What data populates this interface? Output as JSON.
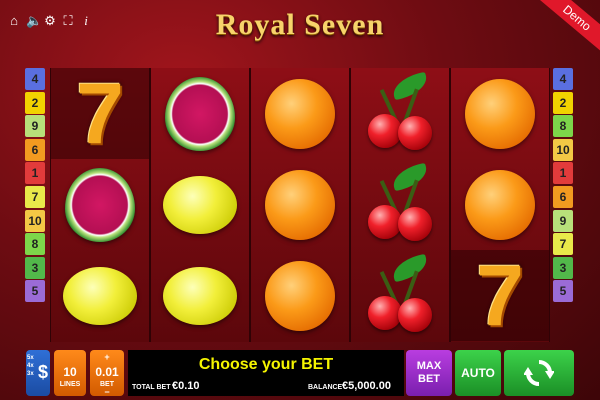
{
  "header": {
    "title": "Royal Seven",
    "demo_label": "Demo",
    "icons": [
      "home-icon",
      "sound-icon",
      "settings-icon",
      "fullscreen-icon",
      "info-icon"
    ]
  },
  "paylines_left": [
    "4",
    "2",
    "9",
    "6",
    "1",
    "7",
    "10",
    "8",
    "3",
    "5"
  ],
  "paylines_right": [
    "4",
    "2",
    "8",
    "10",
    "1",
    "6",
    "9",
    "7",
    "3",
    "5"
  ],
  "payline_colors": {
    "1": "#e23b3b",
    "2": "#f2d200",
    "3": "#52b84a",
    "4": "#5a6fe0",
    "5": "#9b6bd6",
    "6": "#f29a20",
    "7": "#e9e94a",
    "8": "#7dd64a",
    "9": "#b8e07a",
    "10": "#f3c845"
  },
  "reels": [
    [
      "seven",
      "melon",
      "lemon"
    ],
    [
      "melon",
      "lemon",
      "lemon"
    ],
    [
      "orange",
      "orange",
      "orange"
    ],
    [
      "cherry",
      "cherry",
      "cherry"
    ],
    [
      "orange",
      "orange",
      "seven"
    ]
  ],
  "controls": {
    "coin_multipliers": [
      "5x",
      "4x",
      "3x"
    ],
    "coin_symbol": "$",
    "lines_value": "10",
    "lines_label": "LINES",
    "bet_value": "0.01",
    "bet_label": "BET",
    "plus": "+",
    "minus": "−",
    "message": "Choose your BET",
    "total_bet_label": "TOTAL BET",
    "total_bet_value": "€0.10",
    "balance_label": "BALANCE",
    "balance_value": "€5,000.00",
    "max_bet_line1": "MAX",
    "max_bet_line2": "BET",
    "auto_label": "AUTO"
  },
  "colors": {
    "lines_button": "#ff8a1a",
    "max_bet_button": "#b93de0",
    "auto_button": "#3cd24a",
    "message_text": "#f5f500"
  }
}
